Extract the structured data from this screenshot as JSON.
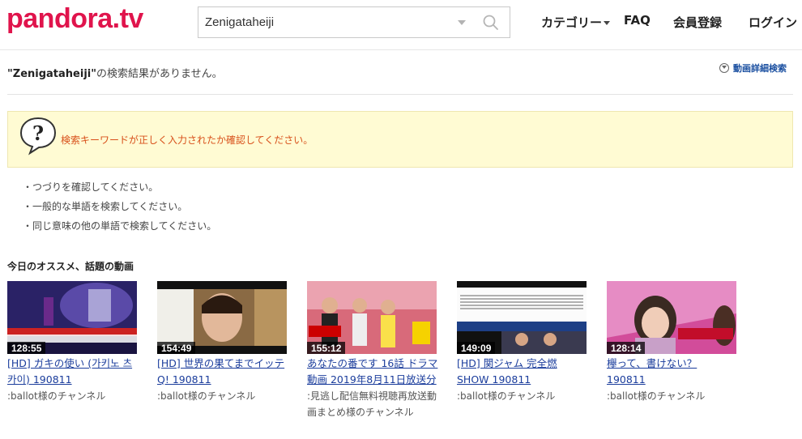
{
  "header": {
    "logo": "pandora.tv",
    "search": {
      "value": "Zenigataheiji",
      "placeholder": ""
    },
    "nav": {
      "category": "カテゴリー",
      "faq": "FAQ",
      "register": "会員登録",
      "login": "ログイン"
    }
  },
  "result": {
    "keyword": "\"Zenigataheiji\"",
    "suffix": "の検索結果がありません。",
    "advanced_search": "動画詳細検索"
  },
  "notice": {
    "message": "検索キーワードが正しく入力されたか確認してください。",
    "icon_symbol": "?"
  },
  "tips": [
    "・つづりを確認してください。",
    "・一般的な単語を検索してください。",
    "・同じ意味の他の単語で検索してください。"
  ],
  "recommend": {
    "title": "今日のオススメ、話題の動画",
    "videos": [
      {
        "duration": "128:55",
        "title": "[HD] ガキの使い (가키노 츠카이) 190811",
        "channel": ":ballot様のチャンネル"
      },
      {
        "duration": "154:49",
        "title": "[HD] 世界の果てまでイッテQ! 190811",
        "channel": ":ballot様のチャンネル"
      },
      {
        "duration": "155:12",
        "title": "あなたの番です 16話 ドラマ動画 2019年8月11日放送分",
        "channel": ":見逃し配信無料視聴再放送動画まとめ様のチャンネル"
      },
      {
        "duration": "149:09",
        "title": "[HD] 関ジャム 完全燃SHOW 190811",
        "channel": ":ballot様のチャンネル"
      },
      {
        "duration": "128:14",
        "title": "欅って、書けない？ 190811",
        "channel": ":ballot様のチャンネル"
      }
    ]
  },
  "colors": {
    "brand": "#e0144c",
    "link": "#1b3d9c",
    "notice_bg": "#fffbd3",
    "notice_text": "#d8501a"
  }
}
